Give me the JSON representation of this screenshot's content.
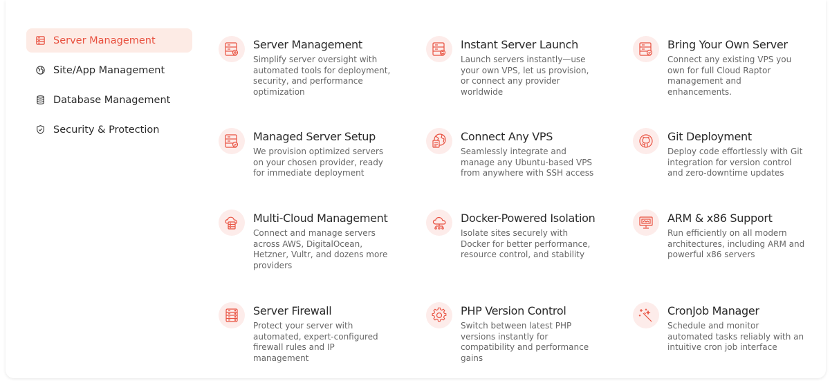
{
  "sidebar": {
    "items": [
      {
        "label": "Server Management",
        "icon": "server-icon",
        "active": true
      },
      {
        "label": "Site/App Management",
        "icon": "globe-icon",
        "active": false
      },
      {
        "label": "Database Management",
        "icon": "database-icon",
        "active": false
      },
      {
        "label": "Security & Protection",
        "icon": "shield-icon",
        "active": false
      }
    ]
  },
  "features": [
    {
      "title": "Server Management",
      "desc": "Simplify server oversight with automated tools for deployment, security, and performance optimization",
      "icon": "server-settings-icon"
    },
    {
      "title": "Instant Server Launch",
      "desc": "Launch servers instantly—use your own VPS, let us provision, or connect any provider worldwide",
      "icon": "server-refresh-icon"
    },
    {
      "title": "Bring Your Own Server",
      "desc": "Connect any existing VPS you own for full Cloud Raptor management and enhancements.",
      "icon": "server-check-icon"
    },
    {
      "title": "Managed Server Setup",
      "desc": "We provision optimized servers on your chosen provider, ready for immediate deployment",
      "icon": "server-check-icon"
    },
    {
      "title": "Connect Any VPS",
      "desc": "Seamlessly integrate and manage any Ubuntu-based VPS from anywhere with SSH access",
      "icon": "globe-doc-icon"
    },
    {
      "title": "Git Deployment",
      "desc": "Deploy code effortlessly with Git integration for version control and zero-downtime updates",
      "icon": "github-icon"
    },
    {
      "title": "Multi-Cloud Management",
      "desc": "Connect and manage servers across AWS, DigitalOcean, Hetzner, Vultr, and dozens more providers",
      "icon": "cloud-server-icon"
    },
    {
      "title": "Docker-Powered Isolation",
      "desc": "Isolate sites securely with Docker for better performance, resource control, and stability",
      "icon": "cloud-network-icon"
    },
    {
      "title": "ARM & x86 Support",
      "desc": "Run efficiently on all modern architectures, including ARM and powerful x86 servers",
      "icon": "monitor-icon"
    },
    {
      "title": "Server Firewall",
      "desc": "Protect your server with automated, expert-configured firewall rules and IP management",
      "icon": "server-firewall-icon"
    },
    {
      "title": "PHP Version Control",
      "desc": "Switch between latest PHP versions instantly for compatibility and performance gains",
      "icon": "gear-icon"
    },
    {
      "title": "CronJob Manager",
      "desc": "Schedule and monitor automated tasks reliably with an intuitive cron job interface",
      "icon": "magic-wand-icon"
    }
  ],
  "colors": {
    "accent": "#e8503f",
    "icon_bg": "#fdecea",
    "active_bg": "#fdebe5",
    "brand_red": "#e8323f"
  }
}
